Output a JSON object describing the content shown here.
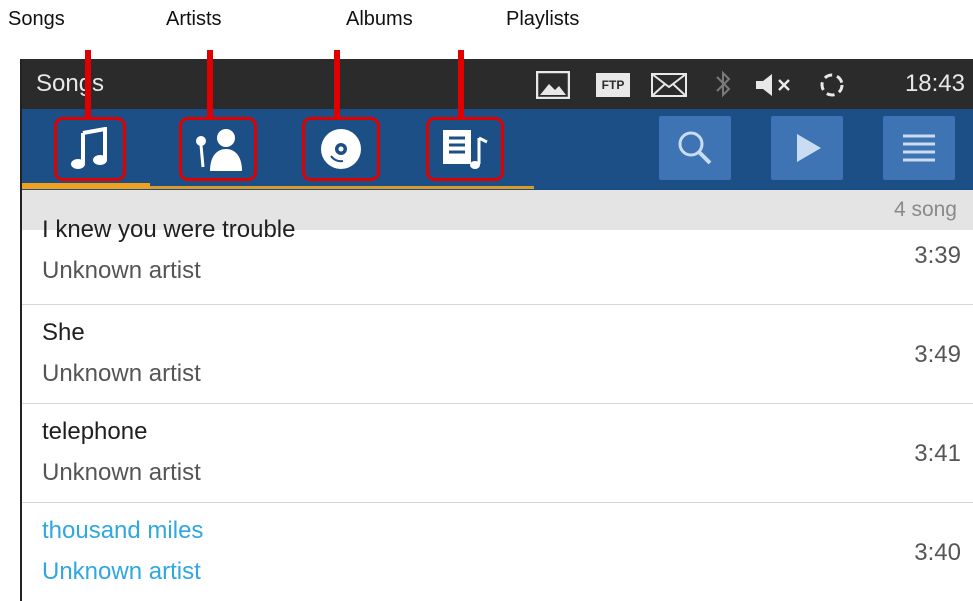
{
  "annotations": {
    "songs": "Songs",
    "artists": "Artists",
    "albums": "Albums",
    "playlists": "Playlists"
  },
  "statusbar": {
    "title": "Songs",
    "ftp_label": "FTP",
    "time": "18:43"
  },
  "tabs": [
    {
      "name": "songs",
      "icon": "music-note-icon",
      "selected": true
    },
    {
      "name": "artists",
      "icon": "artist-microphone-icon",
      "selected": false
    },
    {
      "name": "albums",
      "icon": "album-disc-icon",
      "selected": false
    },
    {
      "name": "playlists",
      "icon": "playlist-icon",
      "selected": false
    }
  ],
  "actions": [
    "search-icon",
    "play-icon",
    "menu-icon"
  ],
  "list_header": {
    "count_text": "4 song"
  },
  "songs": [
    {
      "title": "I knew you were trouble",
      "artist": "Unknown artist",
      "duration": "3:39"
    },
    {
      "title": "She",
      "artist": "Unknown artist",
      "duration": "3:49"
    },
    {
      "title": "telephone",
      "artist": "Unknown artist",
      "duration": "3:41"
    },
    {
      "title": "thousand miles",
      "artist": "Unknown artist",
      "duration": "3:40",
      "playing": true
    }
  ],
  "colors": {
    "tabbar": "#1b4f86",
    "accent_underline": "#f0a21e",
    "playing_text": "#2fa7e0",
    "annotation_red": "#e00000"
  }
}
